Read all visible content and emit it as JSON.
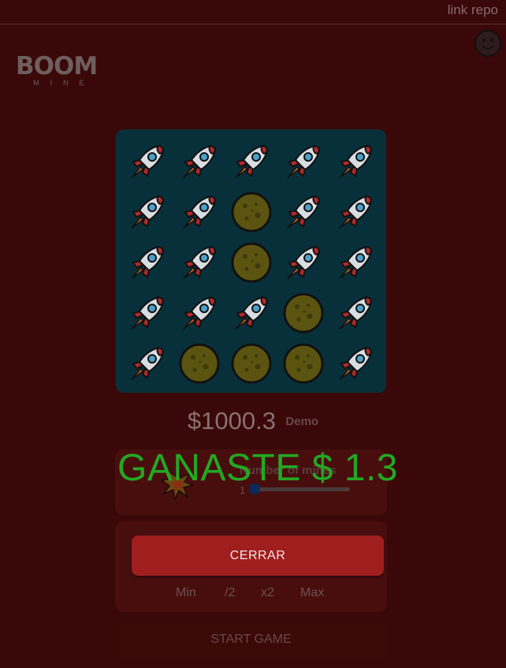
{
  "header": {
    "repo_link": "link repo"
  },
  "logo": {
    "main": "BOOM",
    "sub": "MINE"
  },
  "board": {
    "rows": 5,
    "cols": 5,
    "cells": [
      "rocket",
      "rocket",
      "rocket",
      "rocket",
      "rocket",
      "rocket",
      "rocket",
      "moon",
      "rocket",
      "rocket",
      "rocket",
      "rocket",
      "moon",
      "rocket",
      "rocket",
      "rocket",
      "rocket",
      "rocket",
      "moon",
      "rocket",
      "rocket",
      "moon",
      "moon",
      "moon",
      "rocket"
    ]
  },
  "wallet": {
    "balance": "$1000.3",
    "mode": "Demo"
  },
  "mines": {
    "label": "Number of mines",
    "value": "1",
    "count": 1,
    "max": 24
  },
  "result": {
    "message": "GANASTE $ 1.3"
  },
  "actions": {
    "close_label": "CERRAR",
    "bet_buttons": [
      "Min",
      "/2",
      "x2",
      "Max"
    ],
    "start_label": "START GAME"
  },
  "colors": {
    "background": "#3a0808",
    "board": "#08303a",
    "win_text": "#23a823",
    "close_button": "#a01e1e"
  }
}
